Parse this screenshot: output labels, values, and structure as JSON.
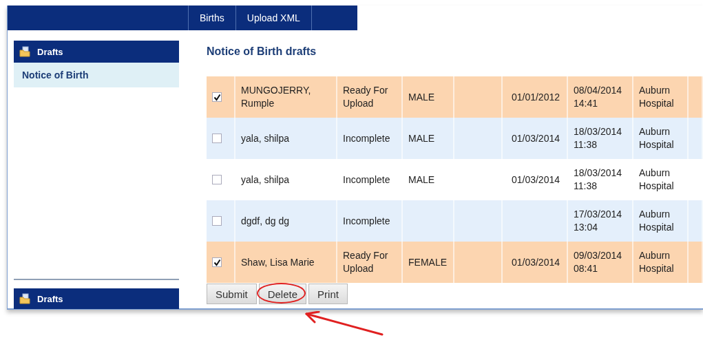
{
  "nav": {
    "tabs": [
      {
        "label": "Births"
      },
      {
        "label": "Upload XML"
      }
    ]
  },
  "sidebar": {
    "header": "Drafts",
    "items": [
      {
        "label": "Notice of Birth",
        "selected": true
      }
    ],
    "footer_header": "Drafts"
  },
  "title": "Notice of Birth drafts",
  "rows": [
    {
      "checked": true,
      "name": "MUNGOJERRY, Rumple",
      "status": "Ready For Upload",
      "gender": "MALE",
      "date": "01/01/2012",
      "modified": "08/04/2014 14:41",
      "hospital": "Auburn Hospital"
    },
    {
      "checked": false,
      "name": "yala, shilpa",
      "status": "Incomplete",
      "gender": "MALE",
      "date": "01/03/2014",
      "modified": "18/03/2014 11:38",
      "hospital": "Auburn Hospital"
    },
    {
      "checked": false,
      "name": "yala, shilpa",
      "status": "Incomplete",
      "gender": "MALE",
      "date": "01/03/2014",
      "modified": "18/03/2014 11:38",
      "hospital": "Auburn Hospital"
    },
    {
      "checked": false,
      "name": "dgdf, dg dg",
      "status": "Incomplete",
      "modified": "17/03/2014 13:04",
      "hospital": "Auburn Hospital"
    },
    {
      "checked": true,
      "name": "Shaw, Lisa Marie",
      "status": "Ready For Upload",
      "gender": "FEMALE",
      "date": "01/03/2014",
      "modified": "09/03/2014 08:41",
      "hospital": "Auburn Hospital"
    }
  ],
  "buttons": [
    {
      "label": "Submit",
      "highlighted": false
    },
    {
      "label": "Delete",
      "highlighted": true
    },
    {
      "label": "Print",
      "highlighted": false
    }
  ]
}
